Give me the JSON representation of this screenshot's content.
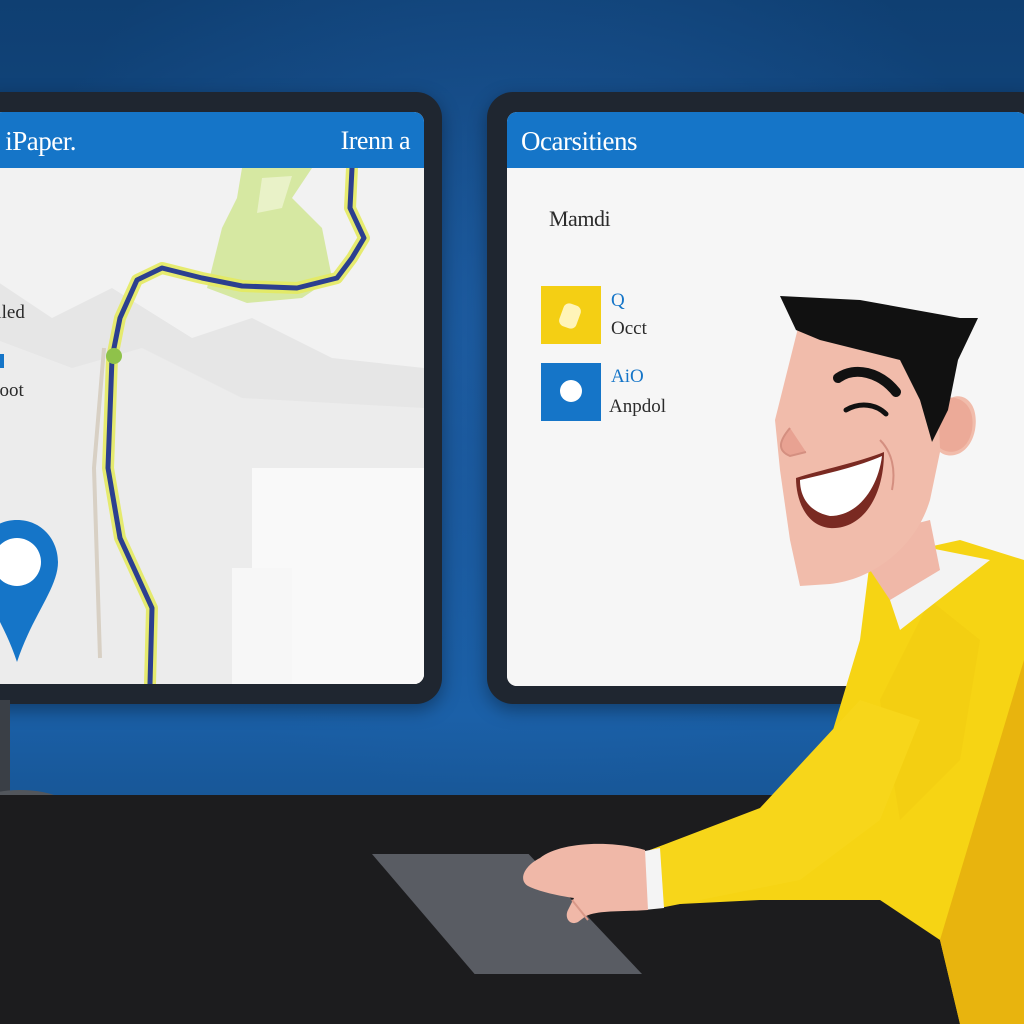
{
  "left_window": {
    "title_left": "p iPaper.",
    "title_right": "Irenn a",
    "side_label_1": "filed",
    "side_label_2": "ooot"
  },
  "right_window": {
    "title": "Ocarsitiens",
    "heading": "Mamdi",
    "options": [
      {
        "top": "Q",
        "bottom": "Occt"
      },
      {
        "top": "AiO",
        "bottom": "Anpdol"
      }
    ]
  },
  "colors": {
    "accent_blue": "#1575c8",
    "option_yellow": "#f4cf14",
    "sweater_yellow": "#f6d414",
    "route_blue": "#2c3f8f",
    "background_blue": "#15508f"
  },
  "icons": [
    "map-pin-icon",
    "route-line",
    "yellow-option-icon",
    "blue-option-icon"
  ]
}
